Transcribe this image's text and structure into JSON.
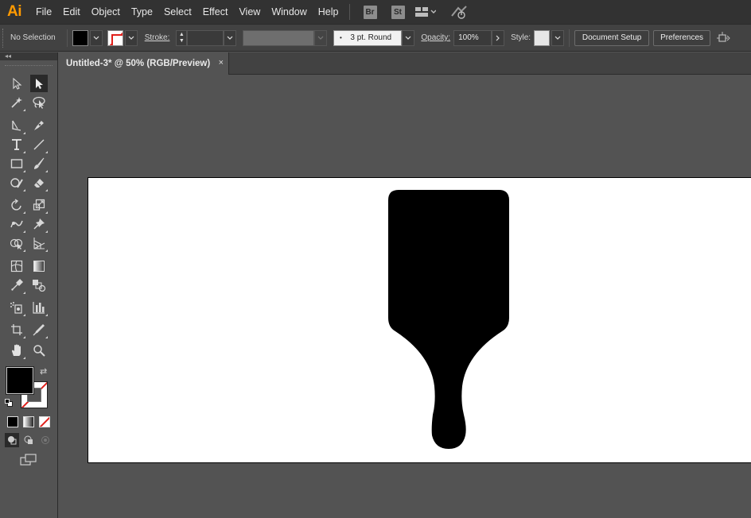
{
  "app": {
    "logo": "Ai"
  },
  "menu": {
    "items": [
      "File",
      "Edit",
      "Object",
      "Type",
      "Select",
      "Effect",
      "View",
      "Window",
      "Help"
    ],
    "bridge": "Br",
    "stock": "St",
    "icons": [
      "workspace-switcher-icon",
      "gpu-performance-icon"
    ]
  },
  "control": {
    "selection_status": "No Selection",
    "fill_color": "#000000",
    "stroke_label": "Stroke:",
    "brush_value": "3 pt. Round",
    "opacity_label": "Opacity:",
    "opacity_value": "100%",
    "style_label": "Style:",
    "document_setup": "Document Setup",
    "preferences": "Preferences"
  },
  "document": {
    "tab_title": "Untitled-3* @ 50% (RGB/Preview)",
    "close_glyph": "×"
  },
  "tools_panel": {
    "collapse_glyph": "◂◂",
    "fill_color": "#000000",
    "stroke_color": "#ffffff",
    "none_indicator_color": "#e0201b"
  },
  "artwork": {
    "shape": "paintbrush-silhouette",
    "fill": "#000000"
  }
}
